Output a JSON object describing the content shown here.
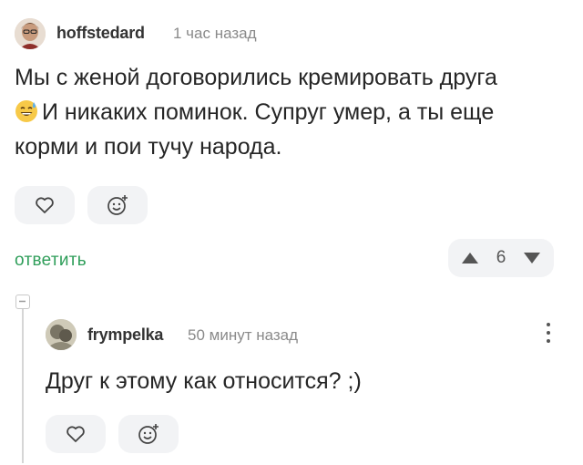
{
  "comment": {
    "author": "hoffstedard",
    "time": "1 час назад",
    "text_line1": "Мы с женой договорились кремировать друга",
    "text_line2": "И никаких поминок. Супруг умер, а ты еще",
    "text_line3": "корми и пои тучу народа.",
    "emoji_icon": "sweat-smile-emoji",
    "reply_label": "ответить",
    "rating": "6"
  },
  "reply": {
    "author": "frympelka",
    "time": "50 минут назад",
    "text": "Друг к этому как относится? ;)"
  },
  "colors": {
    "accent_green": "#2f9e5a",
    "pill_bg": "#f2f3f5",
    "muted": "#8a8a8a"
  }
}
